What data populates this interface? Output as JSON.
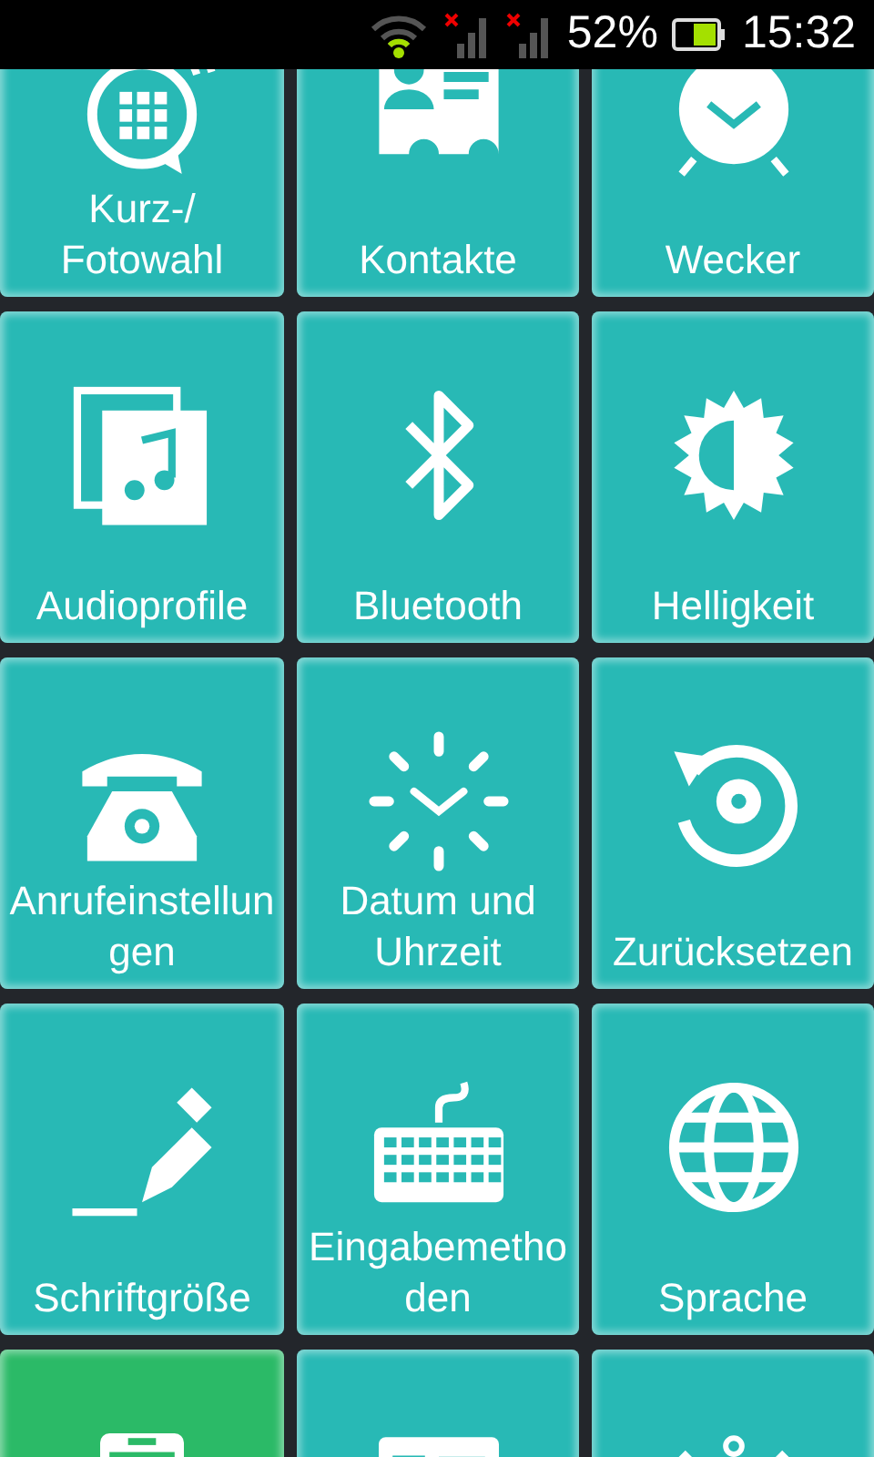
{
  "status_bar": {
    "battery": "52%",
    "time": "15:32"
  },
  "tiles": [
    {
      "kind": "speed-dial",
      "label": "Kurz-/ Fotowahl",
      "color": "#28b9b5"
    },
    {
      "kind": "contact-card",
      "label": "Kontakte",
      "color": "#28b9b5"
    },
    {
      "kind": "alarm-clock",
      "label": "Wecker",
      "color": "#28b9b5"
    },
    {
      "kind": "music-files",
      "label": "Audioprofile",
      "color": "#28b9b5"
    },
    {
      "kind": "bluetooth",
      "label": "Bluetooth",
      "color": "#28b9b5"
    },
    {
      "kind": "brightness",
      "label": "Helligkeit",
      "color": "#28b9b5"
    },
    {
      "kind": "telephone",
      "label": "Anrufeinstellungen",
      "color": "#28b9b5"
    },
    {
      "kind": "clock",
      "label": "Datum und Uhrzeit",
      "color": "#28b9b5"
    },
    {
      "kind": "reset",
      "label": "Zurücksetzen",
      "color": "#28b9b5"
    },
    {
      "kind": "pen",
      "label": "Schriftgröße",
      "color": "#28b9b5"
    },
    {
      "kind": "keyboard",
      "label": "Eingabemethoden",
      "color": "#28b9b5"
    },
    {
      "kind": "globe",
      "label": "Sprache",
      "color": "#28b9b5"
    },
    {
      "kind": "phone-screen",
      "color": "#2bba67"
    },
    {
      "kind": "news",
      "color": "#28b9b5"
    },
    {
      "kind": "dots",
      "color": "#28b9b5"
    }
  ]
}
